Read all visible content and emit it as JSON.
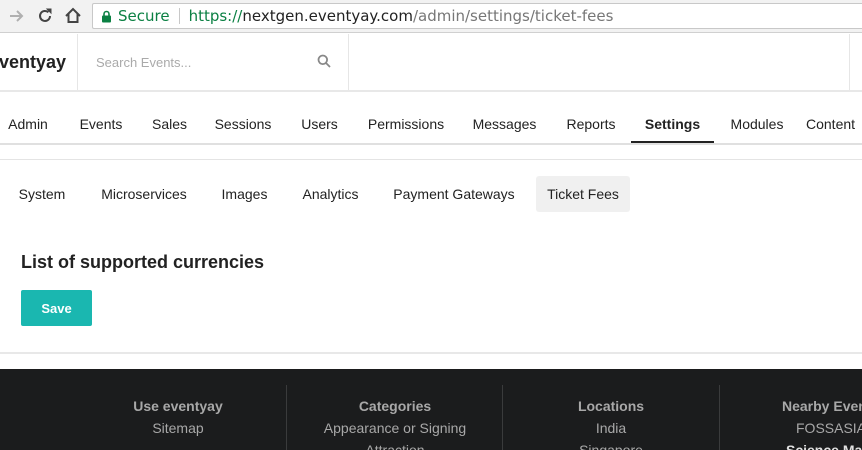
{
  "browser": {
    "secure_label": "Secure",
    "url_scheme": "https://",
    "url_host": "nextgen.eventyay.com",
    "url_path": "/admin/settings/ticket-fees"
  },
  "header": {
    "brand": "eventyay",
    "search_placeholder": "Search Events..."
  },
  "admin_nav": [
    {
      "label": "Admin"
    },
    {
      "label": "Events"
    },
    {
      "label": "Sales"
    },
    {
      "label": "Sessions"
    },
    {
      "label": "Users"
    },
    {
      "label": "Permissions"
    },
    {
      "label": "Messages"
    },
    {
      "label": "Reports"
    },
    {
      "label": "Settings",
      "active": true
    },
    {
      "label": "Modules"
    },
    {
      "label": "Content"
    }
  ],
  "settings_tabs": [
    {
      "label": "System"
    },
    {
      "label": "Microservices"
    },
    {
      "label": "Images"
    },
    {
      "label": "Analytics"
    },
    {
      "label": "Payment Gateways"
    },
    {
      "label": "Ticket Fees",
      "active": true
    }
  ],
  "main": {
    "title": "List of supported currencies",
    "save_label": "Save"
  },
  "footer": {
    "columns": [
      {
        "heading": "Use eventyay",
        "links": [
          "Sitemap"
        ]
      },
      {
        "heading": "Categories",
        "links": [
          "Appearance or Signing",
          "Attraction"
        ]
      },
      {
        "heading": "Locations",
        "links": [
          "India",
          "Singapore"
        ]
      },
      {
        "heading": "Nearby Events",
        "links": [
          "FOSSASIA",
          "Science Ma"
        ]
      }
    ]
  },
  "colors": {
    "accent": "#1ab7b0",
    "footer_bg": "#1b1c1d",
    "secure_green": "#0b8043"
  }
}
